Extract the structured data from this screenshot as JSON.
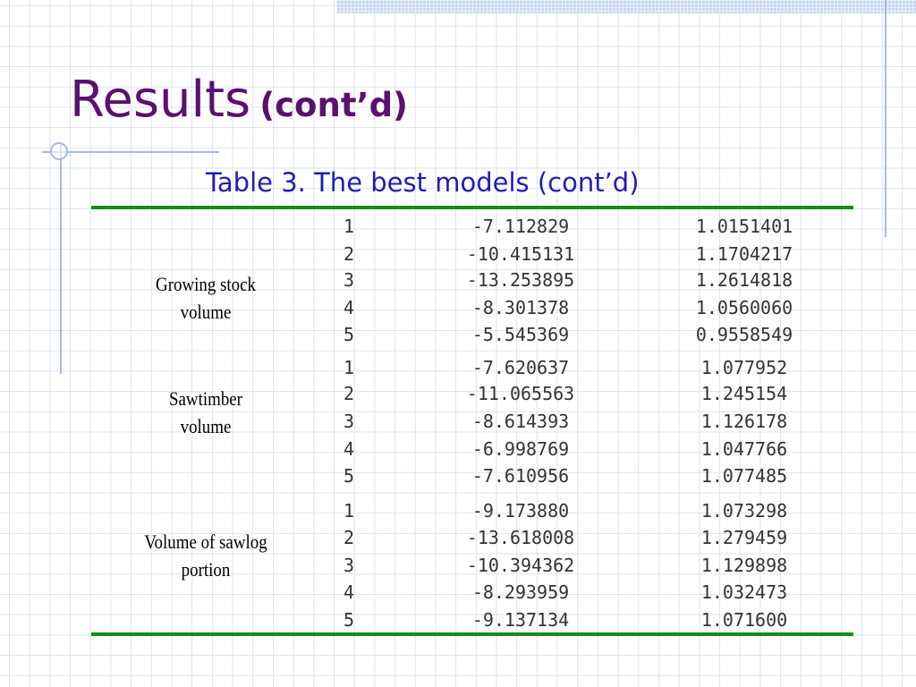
{
  "slide": {
    "title": "Results",
    "title_suffix": "(cont’d)",
    "caption": "Table 3. The best models (cont’d)"
  },
  "table": {
    "groups": [
      {
        "label_lines": [
          "Growing stock",
          "volume"
        ],
        "rows": [
          {
            "model": "1",
            "a": "-7.112829",
            "b": "1.0151401"
          },
          {
            "model": "2",
            "a": "-10.415131",
            "b": "1.1704217"
          },
          {
            "model": "3",
            "a": "-13.253895",
            "b": "1.2614818"
          },
          {
            "model": "4",
            "a": "-8.301378",
            "b": "1.0560060"
          },
          {
            "model": "5",
            "a": "-5.545369",
            "b": "0.9558549"
          }
        ]
      },
      {
        "label_lines": [
          "Sawtimber",
          "volume"
        ],
        "rows": [
          {
            "model": "1",
            "a": "-7.620637",
            "b": "1.077952"
          },
          {
            "model": "2",
            "a": "-11.065563",
            "b": "1.245154"
          },
          {
            "model": "3",
            "a": "-8.614393",
            "b": "1.126178"
          },
          {
            "model": "4",
            "a": "-6.998769",
            "b": "1.047766"
          },
          {
            "model": "5",
            "a": "-7.610956",
            "b": "1.077485"
          }
        ]
      },
      {
        "label_lines": [
          "Volume of sawlog",
          "portion"
        ],
        "rows": [
          {
            "model": "1",
            "a": "-9.173880",
            "b": "1.073298"
          },
          {
            "model": "2",
            "a": "-13.618008",
            "b": "1.279459"
          },
          {
            "model": "3",
            "a": "-10.394362",
            "b": "1.129898"
          },
          {
            "model": "4",
            "a": "-8.293959",
            "b": "1.032473"
          },
          {
            "model": "5",
            "a": "-9.137134",
            "b": "1.071600"
          }
        ]
      }
    ]
  }
}
